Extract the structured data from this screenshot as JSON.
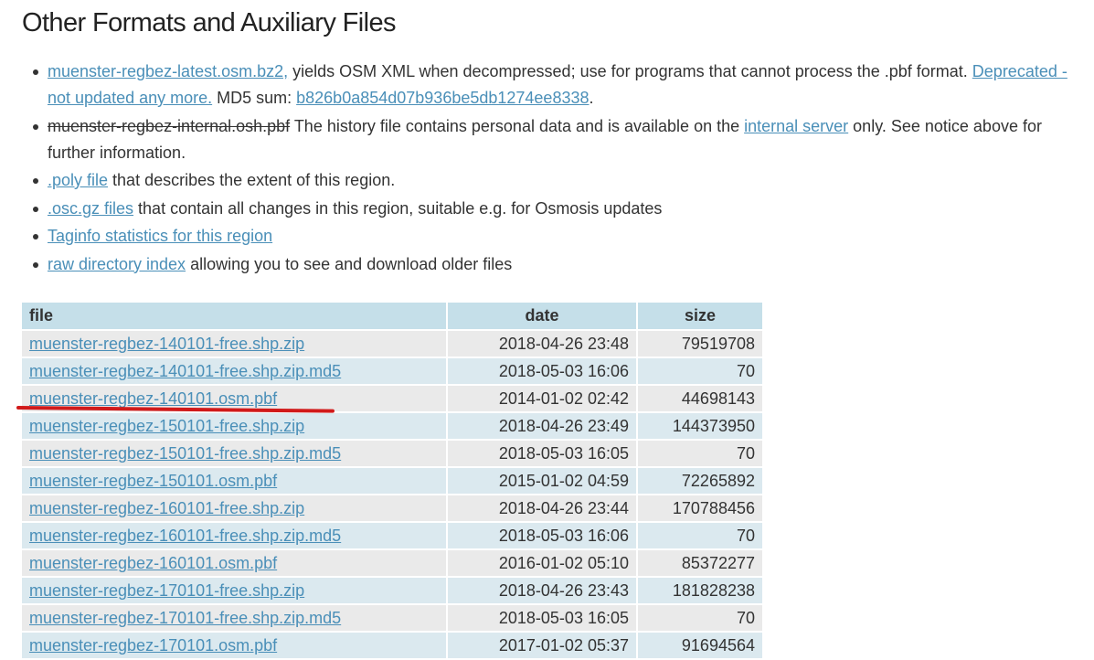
{
  "heading": "Other Formats and Auxiliary Files",
  "bullets": {
    "b1": {
      "link": "muenster-regbez-latest.osm.bz2,",
      "text1": " yields OSM XML when decompressed; use for programs that cannot process the .pbf format. ",
      "deprecated_link": "Deprecated - not updated any more.",
      "md5_label": " MD5 sum: ",
      "md5_link": "b826b0a854d07b936be5db1274ee8338",
      "end": "."
    },
    "b2": {
      "struck": "muenster-regbez-internal.osh.pbf",
      "text1": " The history file contains personal data and is available on the ",
      "link": "internal server",
      "text2": " only. See notice above for further information."
    },
    "b3": {
      "link": ".poly file",
      "text": " that describes the extent of this region."
    },
    "b4": {
      "link": ".osc.gz files",
      "text": " that contain all changes in this region, suitable e.g. for Osmosis updates"
    },
    "b5": {
      "link": "Taginfo statistics for this region"
    },
    "b6": {
      "link": "raw directory index",
      "text": " allowing you to see and download older files"
    }
  },
  "table": {
    "headers": {
      "file": "file",
      "date": "date",
      "size": "size"
    },
    "rows": [
      {
        "file": "muenster-regbez-140101-free.shp.zip",
        "date": "2018-04-26 23:48",
        "size": "79519708"
      },
      {
        "file": "muenster-regbez-140101-free.shp.zip.md5",
        "date": "2018-05-03 16:06",
        "size": "70"
      },
      {
        "file": "muenster-regbez-140101.osm.pbf",
        "date": "2014-01-02 02:42",
        "size": "44698143"
      },
      {
        "file": "muenster-regbez-150101-free.shp.zip",
        "date": "2018-04-26 23:49",
        "size": "144373950"
      },
      {
        "file": "muenster-regbez-150101-free.shp.zip.md5",
        "date": "2018-05-03 16:05",
        "size": "70"
      },
      {
        "file": "muenster-regbez-150101.osm.pbf",
        "date": "2015-01-02 04:59",
        "size": "72265892"
      },
      {
        "file": "muenster-regbez-160101-free.shp.zip",
        "date": "2018-04-26 23:44",
        "size": "170788456"
      },
      {
        "file": "muenster-regbez-160101-free.shp.zip.md5",
        "date": "2018-05-03 16:06",
        "size": "70"
      },
      {
        "file": "muenster-regbez-160101.osm.pbf",
        "date": "2016-01-02 05:10",
        "size": "85372277"
      },
      {
        "file": "muenster-regbez-170101-free.shp.zip",
        "date": "2018-04-26 23:43",
        "size": "181828238"
      },
      {
        "file": "muenster-regbez-170101-free.shp.zip.md5",
        "date": "2018-05-03 16:05",
        "size": "70"
      },
      {
        "file": "muenster-regbez-170101.osm.pbf",
        "date": "2017-01-02 05:37",
        "size": "91694564"
      }
    ]
  },
  "colors": {
    "link": "#4a8fb8",
    "header_bg": "#c5dfe9",
    "row_bg": "#eaeaea",
    "row_alt_bg": "#dbe9ef",
    "highlight_mark": "#d11a1a"
  }
}
